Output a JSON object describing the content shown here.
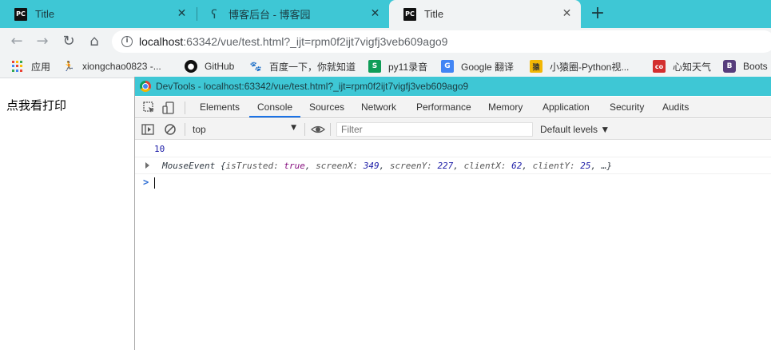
{
  "tabs": [
    {
      "title": "Title",
      "icon": "pycharm-icon",
      "badge": "PC"
    },
    {
      "title": "博客后台 - 博客园",
      "icon": "cnblogs-icon",
      "badge": "ʕ"
    },
    {
      "title": "Title",
      "icon": "pycharm-icon",
      "badge": "PC",
      "active": true
    }
  ],
  "toolbar": {
    "back": "←",
    "forward": "→",
    "reload": "↻",
    "home": "⌂",
    "newtab": "+",
    "close": "✕",
    "info": "i"
  },
  "omnibox": {
    "host": "localhost",
    "path": ":63342/vue/test.html?_ijt=rpm0f2ijt7vigfj3veb609ago9"
  },
  "bookmarks": [
    {
      "label": "应用",
      "icon": "apps-grid-icon"
    },
    {
      "label": "xiongchao0823 -...",
      "icon": "user-icon",
      "badge": "🏃"
    },
    {
      "label": "GitHub",
      "icon": "github-icon",
      "badge": "●"
    },
    {
      "label": "百度一下，你就知道",
      "icon": "baidu-icon",
      "badge": "🐾"
    },
    {
      "label": "py11录音",
      "icon": "sheets-icon",
      "badge": "S"
    },
    {
      "label": "Google 翻译",
      "icon": "translate-icon",
      "badge": "G"
    },
    {
      "label": "小猿圈-Python视...",
      "icon": "yuan-icon",
      "badge": "猿"
    },
    {
      "label": "心知天气",
      "icon": "weather-icon",
      "badge": "co"
    },
    {
      "label": "Boots",
      "icon": "bootstrap-icon",
      "badge": "B"
    }
  ],
  "page": {
    "text": "点我看打印"
  },
  "devtools": {
    "title": "DevTools - localhost:63342/vue/test.html?_ijt=rpm0f2ijt7vigfj3veb609ago9",
    "tabs": [
      "Elements",
      "Console",
      "Sources",
      "Network",
      "Performance",
      "Memory",
      "Application",
      "Security",
      "Audits"
    ],
    "active_tab": "Console",
    "context": "top",
    "context_arrow": "▼",
    "filter_placeholder": "Filter",
    "levels": "Default levels ▼",
    "logs": {
      "number": "10",
      "event": {
        "name": "MouseEvent",
        "isTrusted": "true",
        "screenX": "349",
        "screenY": "227",
        "clientX": "62",
        "clientY": "25",
        "more": "…"
      }
    },
    "prompt": ">"
  },
  "colors": {
    "accent": "#3ec7d5",
    "toolbar": "#f1f3f4",
    "link": "#1a73e8"
  }
}
